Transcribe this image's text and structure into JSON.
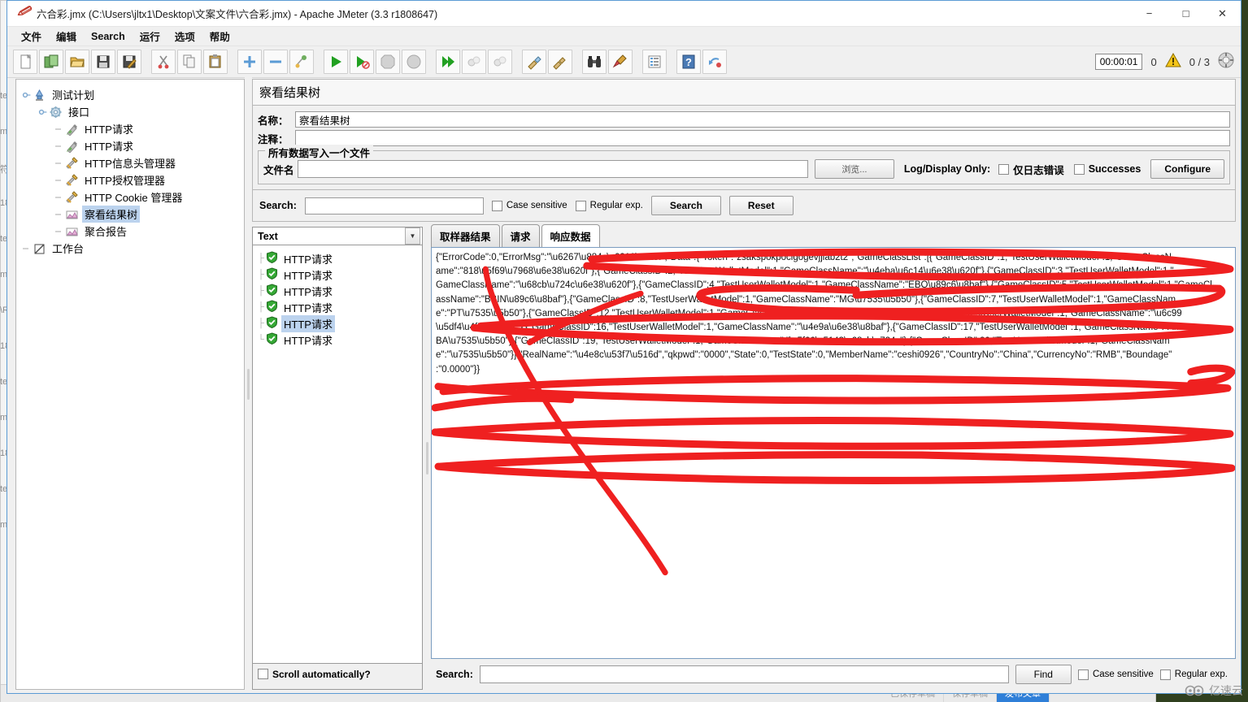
{
  "window": {
    "title": "六合彩.jmx (C:\\Users\\jltx1\\Desktop\\文案文件\\六合彩.jmx) - Apache JMeter (3.3 r1808647)",
    "minimize": "−",
    "maximize": "□",
    "close": "✕"
  },
  "menubar": [
    {
      "label": "文件",
      "name": "menu-file"
    },
    {
      "label": "编辑",
      "name": "menu-edit"
    },
    {
      "label": "Search",
      "name": "menu-search"
    },
    {
      "label": "运行",
      "name": "menu-run"
    },
    {
      "label": "选项",
      "name": "menu-options"
    },
    {
      "label": "帮助",
      "name": "menu-help"
    }
  ],
  "toolbar": {
    "buttons": [
      {
        "name": "new-icon",
        "glyph": "new"
      },
      {
        "name": "templates-icon",
        "glyph": "templates"
      },
      {
        "name": "open-icon",
        "glyph": "open"
      },
      {
        "name": "save-icon",
        "glyph": "save"
      },
      {
        "name": "save-as-icon",
        "glyph": "saveas"
      },
      {
        "name": "cut-icon",
        "glyph": "cut"
      },
      {
        "name": "copy-icon",
        "glyph": "copy"
      },
      {
        "name": "paste-icon",
        "glyph": "paste"
      },
      {
        "name": "expand-icon",
        "glyph": "plus"
      },
      {
        "name": "collapse-icon",
        "glyph": "minus"
      },
      {
        "name": "toggle-icon",
        "glyph": "toggle"
      },
      {
        "name": "start-icon",
        "glyph": "start"
      },
      {
        "name": "start-no-pause-icon",
        "glyph": "startnopause"
      },
      {
        "name": "stop-icon",
        "glyph": "stop"
      },
      {
        "name": "shutdown-icon",
        "glyph": "shutdown"
      },
      {
        "name": "start-remote-icon",
        "glyph": "remotestart"
      },
      {
        "name": "stop-remote-icon",
        "glyph": "remotestop"
      },
      {
        "name": "shutdown-remote-icon",
        "glyph": "remoteshutdown"
      },
      {
        "name": "clear-icon",
        "glyph": "clear"
      },
      {
        "name": "clear-all-icon",
        "glyph": "clearall"
      },
      {
        "name": "search-icon",
        "glyph": "binoculars"
      },
      {
        "name": "search-reset-icon",
        "glyph": "broom"
      },
      {
        "name": "function-helper-icon",
        "glyph": "funchelper"
      },
      {
        "name": "help-icon",
        "glyph": "help"
      },
      {
        "name": "undo-icon",
        "glyph": "undo"
      }
    ],
    "timer": "00:00:01",
    "warning_count": "0",
    "thread_count": "0 / 3"
  },
  "tree": {
    "nodes": [
      {
        "label": "测试计划",
        "depth": 0,
        "icon": "test-plan-icon",
        "selected": false,
        "expander": true
      },
      {
        "label": "接口",
        "depth": 1,
        "icon": "thread-group-icon",
        "selected": false,
        "expander": true
      },
      {
        "label": "HTTP请求",
        "depth": 2,
        "icon": "http-sampler-icon",
        "selected": false,
        "expander": false
      },
      {
        "label": "HTTP请求",
        "depth": 2,
        "icon": "http-sampler-icon",
        "selected": false,
        "expander": false
      },
      {
        "label": "HTTP信息头管理器",
        "depth": 2,
        "icon": "header-manager-icon",
        "selected": false,
        "expander": false
      },
      {
        "label": "HTTP授权管理器",
        "depth": 2,
        "icon": "auth-manager-icon",
        "selected": false,
        "expander": false
      },
      {
        "label": "HTTP Cookie 管理器",
        "depth": 2,
        "icon": "cookie-manager-icon",
        "selected": false,
        "expander": false
      },
      {
        "label": "察看结果树",
        "depth": 2,
        "icon": "view-results-tree-icon",
        "selected": true,
        "expander": false
      },
      {
        "label": "聚合报告",
        "depth": 2,
        "icon": "aggregate-report-icon",
        "selected": false,
        "expander": false
      },
      {
        "label": "工作台",
        "depth": 0,
        "icon": "workbench-icon",
        "selected": false,
        "expander": false
      }
    ]
  },
  "panel": {
    "header": "察看结果树",
    "name_label": "名称：",
    "name_value": "察看结果树",
    "comment_label": "注释：",
    "comment_value": "",
    "filegroup_title": "所有数据写入一个文件",
    "filename_label": "文件名",
    "filename_value": "",
    "browse_button": "浏览...",
    "log_display_label": "Log/Display Only:",
    "errors_only_label": "仅日志错误",
    "successes_label": "Successes",
    "configure_button": "Configure",
    "errors_only_checked": false,
    "successes_checked": false
  },
  "search_bar": {
    "label": "Search:",
    "value": "",
    "case_sensitive_label": "Case sensitive",
    "regular_exp_label": "Regular exp.",
    "search_button": "Search",
    "reset_button": "Reset",
    "case_sensitive_checked": false,
    "regular_exp_checked": false
  },
  "results": {
    "render_selector": "Text",
    "samplers": [
      {
        "label": "HTTP请求",
        "status": "success",
        "selected": false
      },
      {
        "label": "HTTP请求",
        "status": "success",
        "selected": false
      },
      {
        "label": "HTTP请求",
        "status": "success",
        "selected": false
      },
      {
        "label": "HTTP请求",
        "status": "success",
        "selected": false
      },
      {
        "label": "HTTP请求",
        "status": "success",
        "selected": true
      },
      {
        "label": "HTTP请求",
        "status": "success",
        "selected": false
      }
    ],
    "scroll_label": "Scroll automatically?",
    "scroll_checked": false,
    "tabs": [
      {
        "label": "取样器结果",
        "active": false,
        "name": "tab-sampler-result"
      },
      {
        "label": "请求",
        "active": false,
        "name": "tab-request"
      },
      {
        "label": "响应数据",
        "active": true,
        "name": "tab-response-data"
      }
    ],
    "response_lines": [
      "{\"ErrorCode\":0,\"ErrorMsg\":\"\\u6267\\u884c\\u6210\\u529f\",\"Data\":{\"Token\":\"zsakspokpoclgogevjjiab2t2\",\"GameClassList\":[{\"GameClassID\":1,\"TestUserWalletModel\":1,\"GameClassN",
      "ame\":\"818\\u5f69\\u7968\\u6e38\\u620f\"},{\"GameClassID\":2,\"TestUserWalletModel\":1,\"GameClassName\":\"\\u4eba\\u6c14\\u6e38\\u620f\"},{\"GameClassID\":3,\"TestUserWalletModel\":1,\"",
      "GameClassName\":\"\\u68cb\\u724c\\u6e38\\u620f\"},{\"GameClassID\":4,\"TestUserWalletModel\":1,\"GameClassName\":\"EBO\\u89c6\\u8baf\"},{\"GameClassID\":5,\"TestUserWalletModel\":1,\"GameCl",
      "assName\":\"BBIN\\u89c6\\u8baf\"},{\"GameClassID\":8,\"TestUserWalletModel\":1,\"GameClassName\":\"MG\\u7535\\u5b50\"},{\"GameClassID\":7,\"TestUserWalletModel\":1,\"GameClassNam",
      "e\":\"PT\\u7535\\u5b50\"},{\"GameClassID\":12,\"TestUserWalletModel\":1,\"GameClassName\":\"AB\\u89c6\\u8baf\"},{\"GameClassID\":15,\"TestUserWalletModel\":1,\"GameClassName\":\"\\u6c99",
      "\\u5df4\\u4f53\\u80b2\"},{\"GameClassID\":16,\"TestUserWalletModel\":1,\"GameClassName\":\"\\u4e9a\\u6e38\\u8baf\"},{\"GameClassID\":17,\"TestUserWalletModel\":1,\"GameClassName\":\"AME",
      "BA\\u7535\\u5b50\"},{\"GameClassID\":19,\"TestUserWalletModel\":1,\"GameClassName\":\"\\u5f00\\u5143\\u68cb\\u724c\"},{\"GameClassID\":20,\"TestUserWalletModel\":1,\"GameClassNam",
      "e\":\"\\u7535\\u5b50\"}],\"RealName\":\"\\u4e8c\\u53f7\\u516d\",\"qkpwd\":\"0000\",\"State\":0,\"TestState\":0,\"MemberName\":\"ceshi0926\",\"CountryNo\":\"China\",\"CurrencyNo\":\"RMB\",\"Boundage\"",
      ":\"0.0000\"}}"
    ]
  },
  "bottom_search": {
    "label": "Search:",
    "value": "",
    "find_button": "Find",
    "case_sensitive_label": "Case sensitive",
    "regular_exp_label": "Regular exp.",
    "case_sensitive_checked": false,
    "regular_exp_checked": false
  },
  "background": {
    "left_texts": [
      "te",
      "m",
      "符",
      "18",
      "te",
      "m",
      "\\R",
      "18",
      "te",
      "m",
      "18",
      "te",
      "m"
    ],
    "bottom_cells": [
      "已保存草稿",
      "保存草稿",
      "发布文章"
    ]
  },
  "watermark": "亿速云"
}
